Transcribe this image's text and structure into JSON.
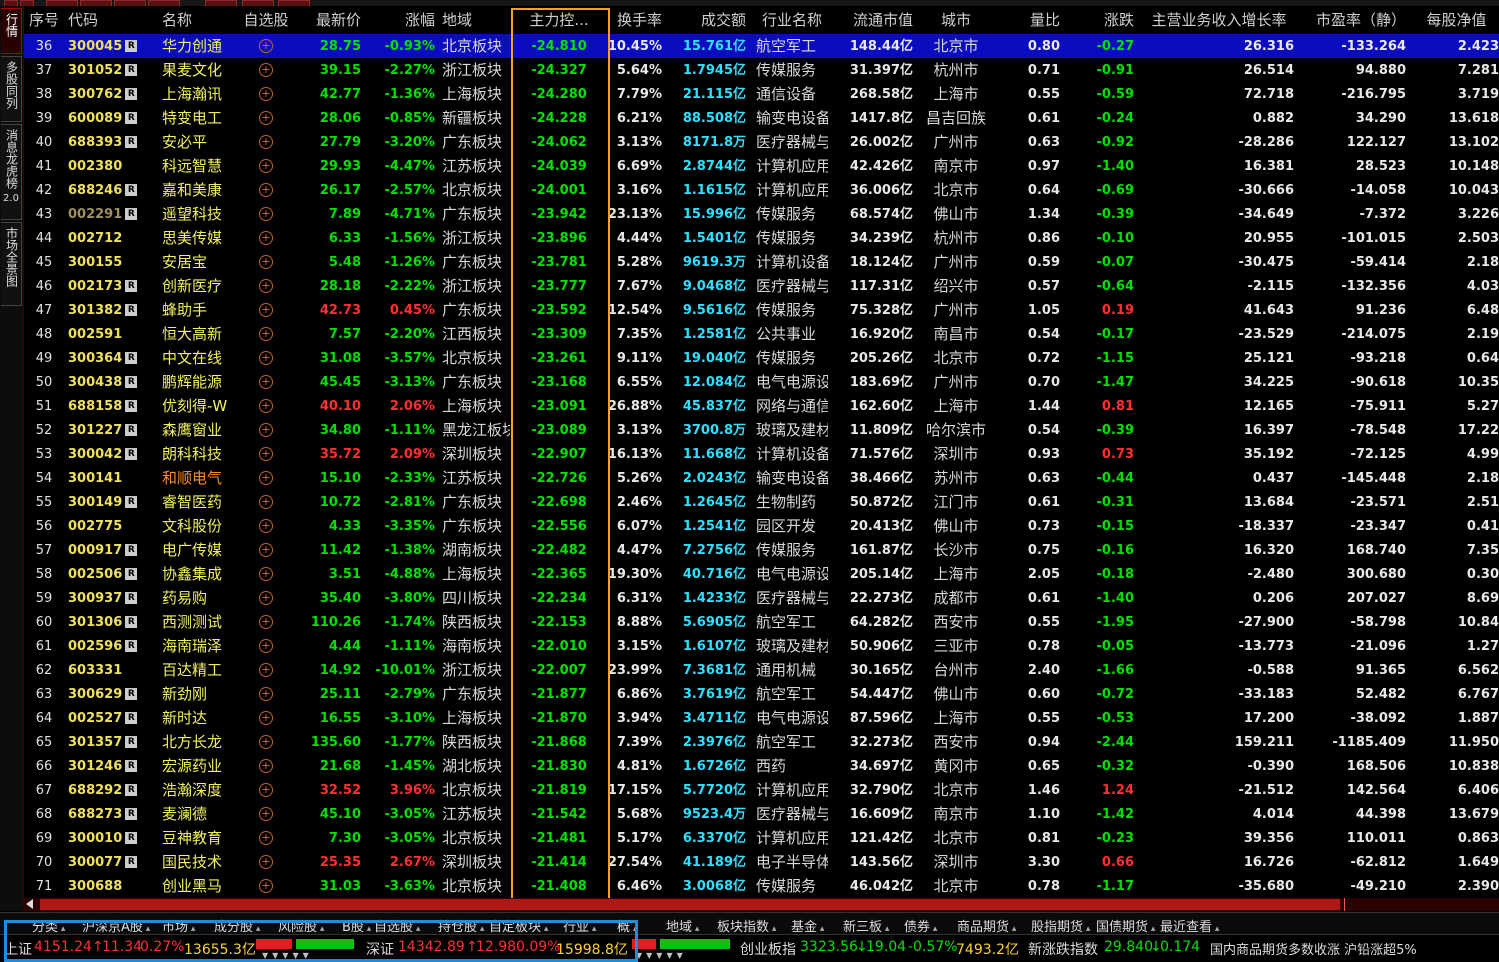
{
  "left_tabs": [
    {
      "label": "行情"
    },
    {
      "label": "多股同列"
    },
    {
      "label": "消息龙虎榜",
      "sub": "2.0"
    },
    {
      "label": "市场全景图"
    }
  ],
  "headers": [
    "序号",
    "代码",
    "名称",
    "自选股",
    "最新价",
    "涨幅",
    "地域",
    "主力控...",
    "换手率",
    "成交额",
    "行业名称",
    "流通市值",
    "城市",
    "量比",
    "涨跌",
    "主营业务收入增长率",
    "市盈率（静）",
    "每股净值"
  ],
  "rows": [
    {
      "seq": "36",
      "code": "300045",
      "r": true,
      "name": "华力创通",
      "price": "28.75",
      "chg_pct": "-0.93%",
      "region": "北京板块",
      "main": "-24.810",
      "turnover": "10.45%",
      "amount": "15.761亿",
      "industry": "航空军工",
      "mcap": "148.44亿",
      "city": "北京市",
      "vr": "0.80",
      "chg": "-0.27",
      "growth": "26.316",
      "pe": "-133.264",
      "bvps": "2.423",
      "selected": true
    },
    {
      "seq": "37",
      "code": "301052",
      "r": true,
      "name": "果麦文化",
      "price": "39.15",
      "chg_pct": "-2.27%",
      "region": "浙江板块",
      "main": "-24.327",
      "turnover": "5.64%",
      "amount": "1.7945亿",
      "industry": "传媒服务",
      "mcap": "31.397亿",
      "city": "杭州市",
      "vr": "0.71",
      "chg": "-0.91",
      "growth": "26.514",
      "pe": "94.880",
      "bvps": "7.281"
    },
    {
      "seq": "38",
      "code": "300762",
      "r": true,
      "name": "上海瀚讯",
      "price": "42.77",
      "chg_pct": "-1.36%",
      "region": "上海板块",
      "main": "-24.280",
      "turnover": "7.79%",
      "amount": "21.115亿",
      "industry": "通信设备",
      "mcap": "268.58亿",
      "city": "上海市",
      "vr": "0.55",
      "chg": "-0.59",
      "growth": "72.718",
      "pe": "-216.795",
      "bvps": "3.719"
    },
    {
      "seq": "39",
      "code": "600089",
      "r": true,
      "name": "特变电工",
      "price": "28.06",
      "chg_pct": "-0.85%",
      "region": "新疆板块",
      "main": "-24.228",
      "turnover": "6.21%",
      "amount": "88.508亿",
      "industry": "输变电设备",
      "mcap": "1417.8亿",
      "city": "昌吉回族",
      "vr": "0.61",
      "chg": "-0.24",
      "growth": "0.882",
      "pe": "34.290",
      "bvps": "13.618"
    },
    {
      "seq": "40",
      "code": "688393",
      "r": true,
      "name": "安必平",
      "price": "27.79",
      "chg_pct": "-3.20%",
      "region": "广东板块",
      "main": "-24.062",
      "turnover": "3.13%",
      "amount": "8171.8万",
      "industry": "医疗器械与",
      "mcap": "26.002亿",
      "city": "广州市",
      "vr": "0.63",
      "chg": "-0.92",
      "growth": "-28.286",
      "pe": "122.127",
      "bvps": "13.102"
    },
    {
      "seq": "41",
      "code": "002380",
      "r": false,
      "name": "科远智慧",
      "price": "29.93",
      "chg_pct": "-4.47%",
      "region": "江苏板块",
      "main": "-24.039",
      "turnover": "6.69%",
      "amount": "2.8744亿",
      "industry": "计算机应用",
      "mcap": "42.426亿",
      "city": "南京市",
      "vr": "0.97",
      "chg": "-1.40",
      "growth": "16.381",
      "pe": "28.523",
      "bvps": "10.148"
    },
    {
      "seq": "42",
      "code": "688246",
      "r": true,
      "name": "嘉和美康",
      "price": "26.17",
      "chg_pct": "-2.57%",
      "region": "北京板块",
      "main": "-24.001",
      "turnover": "3.16%",
      "amount": "1.1615亿",
      "industry": "计算机应用",
      "mcap": "36.006亿",
      "city": "北京市",
      "vr": "0.64",
      "chg": "-0.69",
      "growth": "-30.666",
      "pe": "-14.058",
      "bvps": "10.043"
    },
    {
      "seq": "43",
      "code": "002291",
      "r": true,
      "name": "遥望科技",
      "price": "7.89",
      "chg_pct": "-4.71%",
      "region": "广东板块",
      "main": "-23.942",
      "turnover": "23.13%",
      "amount": "15.996亿",
      "industry": "传媒服务",
      "mcap": "68.574亿",
      "city": "佛山市",
      "vr": "1.34",
      "chg": "-0.39",
      "growth": "-34.649",
      "pe": "-7.372",
      "bvps": "3.226",
      "dim": true
    },
    {
      "seq": "44",
      "code": "002712",
      "r": false,
      "name": "思美传媒",
      "price": "6.33",
      "chg_pct": "-1.56%",
      "region": "浙江板块",
      "main": "-23.896",
      "turnover": "4.44%",
      "amount": "1.5401亿",
      "industry": "传媒服务",
      "mcap": "34.239亿",
      "city": "杭州市",
      "vr": "0.86",
      "chg": "-0.10",
      "growth": "20.955",
      "pe": "-101.015",
      "bvps": "2.503"
    },
    {
      "seq": "45",
      "code": "300155",
      "r": false,
      "name": "安居宝",
      "price": "5.48",
      "chg_pct": "-1.26%",
      "region": "广东板块",
      "main": "-23.781",
      "turnover": "5.28%",
      "amount": "9619.3万",
      "industry": "计算机设备",
      "mcap": "18.124亿",
      "city": "广州市",
      "vr": "0.59",
      "chg": "-0.07",
      "growth": "-30.475",
      "pe": "-59.414",
      "bvps": "2.18"
    },
    {
      "seq": "46",
      "code": "002173",
      "r": true,
      "name": "创新医疗",
      "price": "28.18",
      "chg_pct": "-2.22%",
      "region": "浙江板块",
      "main": "-23.777",
      "turnover": "7.67%",
      "amount": "9.0468亿",
      "industry": "医疗器械与",
      "mcap": "117.31亿",
      "city": "绍兴市",
      "vr": "0.57",
      "chg": "-0.64",
      "growth": "-2.115",
      "pe": "-132.356",
      "bvps": "4.03"
    },
    {
      "seq": "47",
      "code": "301382",
      "r": true,
      "name": "蜂助手",
      "price": "42.73",
      "chg_pct": "0.45%",
      "region": "广东板块",
      "main": "-23.592",
      "turnover": "12.54%",
      "amount": "9.5616亿",
      "industry": "传媒服务",
      "mcap": "75.328亿",
      "city": "广州市",
      "vr": "1.05",
      "chg": "0.19",
      "growth": "41.643",
      "pe": "91.236",
      "bvps": "6.48",
      "up": true
    },
    {
      "seq": "48",
      "code": "002591",
      "r": false,
      "name": "恒大高新",
      "price": "7.57",
      "chg_pct": "-2.20%",
      "region": "江西板块",
      "main": "-23.309",
      "turnover": "7.35%",
      "amount": "1.2581亿",
      "industry": "公共事业",
      "mcap": "16.920亿",
      "city": "南昌市",
      "vr": "0.54",
      "chg": "-0.17",
      "growth": "-23.529",
      "pe": "-214.075",
      "bvps": "2.19"
    },
    {
      "seq": "49",
      "code": "300364",
      "r": true,
      "name": "中文在线",
      "price": "31.08",
      "chg_pct": "-3.57%",
      "region": "北京板块",
      "main": "-23.261",
      "turnover": "9.11%",
      "amount": "19.040亿",
      "industry": "传媒服务",
      "mcap": "205.26亿",
      "city": "北京市",
      "vr": "0.72",
      "chg": "-1.15",
      "growth": "25.121",
      "pe": "-93.218",
      "bvps": "0.64"
    },
    {
      "seq": "50",
      "code": "300438",
      "r": true,
      "name": "鹏辉能源",
      "price": "45.45",
      "chg_pct": "-3.13%",
      "region": "广东板块",
      "main": "-23.168",
      "turnover": "6.55%",
      "amount": "12.084亿",
      "industry": "电气电源设",
      "mcap": "183.69亿",
      "city": "广州市",
      "vr": "0.70",
      "chg": "-1.47",
      "growth": "34.225",
      "pe": "-90.618",
      "bvps": "10.35"
    },
    {
      "seq": "51",
      "code": "688158",
      "r": true,
      "name": "优刻得-W",
      "price": "40.10",
      "chg_pct": "2.06%",
      "region": "上海板块",
      "main": "-23.091",
      "turnover": "26.88%",
      "amount": "45.837亿",
      "industry": "网络与通信",
      "mcap": "162.60亿",
      "city": "上海市",
      "vr": "1.44",
      "chg": "0.81",
      "growth": "12.165",
      "pe": "-75.911",
      "bvps": "5.27",
      "up": true
    },
    {
      "seq": "52",
      "code": "301227",
      "r": true,
      "name": "森鹰窗业",
      "price": "34.80",
      "chg_pct": "-1.11%",
      "region": "黑龙江板块",
      "main": "-23.089",
      "turnover": "3.13%",
      "amount": "3700.8万",
      "industry": "玻璃及建材",
      "mcap": "11.809亿",
      "city": "哈尔滨市",
      "vr": "0.54",
      "chg": "-0.39",
      "growth": "16.397",
      "pe": "-78.548",
      "bvps": "17.22"
    },
    {
      "seq": "53",
      "code": "300042",
      "r": true,
      "name": "朗科科技",
      "price": "35.72",
      "chg_pct": "2.09%",
      "region": "深圳板块",
      "main": "-22.907",
      "turnover": "16.13%",
      "amount": "11.668亿",
      "industry": "计算机设备",
      "mcap": "71.576亿",
      "city": "深圳市",
      "vr": "0.93",
      "chg": "0.73",
      "growth": "35.192",
      "pe": "-72.125",
      "bvps": "4.99",
      "up": true
    },
    {
      "seq": "54",
      "code": "300141",
      "r": false,
      "name": "和顺电气",
      "price": "15.10",
      "chg_pct": "-2.33%",
      "region": "江苏板块",
      "main": "-22.726",
      "turnover": "5.26%",
      "amount": "2.0243亿",
      "industry": "输变电设备",
      "mcap": "38.466亿",
      "city": "苏州市",
      "vr": "0.63",
      "chg": "-0.44",
      "growth": "0.437",
      "pe": "-145.448",
      "bvps": "2.18",
      "orange": true
    },
    {
      "seq": "55",
      "code": "300149",
      "r": true,
      "name": "睿智医药",
      "price": "10.72",
      "chg_pct": "-2.81%",
      "region": "广东板块",
      "main": "-22.698",
      "turnover": "2.46%",
      "amount": "1.2645亿",
      "industry": "生物制药",
      "mcap": "50.872亿",
      "city": "江门市",
      "vr": "0.61",
      "chg": "-0.31",
      "growth": "13.684",
      "pe": "-23.571",
      "bvps": "2.51"
    },
    {
      "seq": "56",
      "code": "002775",
      "r": false,
      "name": "文科股份",
      "price": "4.33",
      "chg_pct": "-3.35%",
      "region": "广东板块",
      "main": "-22.556",
      "turnover": "6.07%",
      "amount": "1.2541亿",
      "industry": "园区开发",
      "mcap": "20.413亿",
      "city": "佛山市",
      "vr": "0.73",
      "chg": "-0.15",
      "growth": "-18.337",
      "pe": "-23.347",
      "bvps": "0.41"
    },
    {
      "seq": "57",
      "code": "000917",
      "r": true,
      "name": "电广传媒",
      "price": "11.42",
      "chg_pct": "-1.38%",
      "region": "湖南板块",
      "main": "-22.482",
      "turnover": "4.47%",
      "amount": "7.2756亿",
      "industry": "传媒服务",
      "mcap": "161.87亿",
      "city": "长沙市",
      "vr": "0.75",
      "chg": "-0.16",
      "growth": "16.320",
      "pe": "168.740",
      "bvps": "7.35"
    },
    {
      "seq": "58",
      "code": "002506",
      "r": true,
      "name": "协鑫集成",
      "price": "3.51",
      "chg_pct": "-4.88%",
      "region": "上海板块",
      "main": "-22.365",
      "turnover": "19.30%",
      "amount": "40.716亿",
      "industry": "电气电源设",
      "mcap": "205.14亿",
      "city": "上海市",
      "vr": "2.05",
      "chg": "-0.18",
      "growth": "-2.480",
      "pe": "300.680",
      "bvps": "0.30"
    },
    {
      "seq": "59",
      "code": "300937",
      "r": true,
      "name": "药易购",
      "price": "35.40",
      "chg_pct": "-3.80%",
      "region": "四川板块",
      "main": "-22.234",
      "turnover": "6.31%",
      "amount": "1.4233亿",
      "industry": "医疗器械与",
      "mcap": "22.273亿",
      "city": "成都市",
      "vr": "0.61",
      "chg": "-1.40",
      "growth": "0.206",
      "pe": "207.027",
      "bvps": "8.69"
    },
    {
      "seq": "60",
      "code": "301306",
      "r": true,
      "name": "西测测试",
      "price": "110.26",
      "chg_pct": "-1.74%",
      "region": "陕西板块",
      "main": "-22.153",
      "turnover": "8.88%",
      "amount": "5.6905亿",
      "industry": "航空军工",
      "mcap": "64.282亿",
      "city": "西安市",
      "vr": "0.55",
      "chg": "-1.95",
      "growth": "-27.900",
      "pe": "-58.798",
      "bvps": "10.84"
    },
    {
      "seq": "61",
      "code": "002596",
      "r": true,
      "name": "海南瑞泽",
      "price": "4.44",
      "chg_pct": "-1.11%",
      "region": "海南板块",
      "main": "-22.010",
      "turnover": "3.15%",
      "amount": "1.6107亿",
      "industry": "玻璃及建材",
      "mcap": "50.906亿",
      "city": "三亚市",
      "vr": "0.78",
      "chg": "-0.05",
      "growth": "-13.773",
      "pe": "-21.096",
      "bvps": "1.27"
    },
    {
      "seq": "62",
      "code": "603331",
      "r": false,
      "name": "百达精工",
      "price": "14.92",
      "chg_pct": "-10.01%",
      "region": "浙江板块",
      "main": "-22.007",
      "turnover": "23.99%",
      "amount": "7.3681亿",
      "industry": "通用机械",
      "mcap": "30.165亿",
      "city": "台州市",
      "vr": "2.40",
      "chg": "-1.66",
      "growth": "-0.588",
      "pe": "91.365",
      "bvps": "6.562"
    },
    {
      "seq": "63",
      "code": "300629",
      "r": true,
      "name": "新劲刚",
      "price": "25.11",
      "chg_pct": "-2.79%",
      "region": "广东板块",
      "main": "-21.877",
      "turnover": "6.86%",
      "amount": "3.7619亿",
      "industry": "航空军工",
      "mcap": "54.447亿",
      "city": "佛山市",
      "vr": "0.60",
      "chg": "-0.72",
      "growth": "-33.183",
      "pe": "52.482",
      "bvps": "6.767"
    },
    {
      "seq": "64",
      "code": "002527",
      "r": true,
      "name": "新时达",
      "price": "16.55",
      "chg_pct": "-3.10%",
      "region": "上海板块",
      "main": "-21.870",
      "turnover": "3.94%",
      "amount": "3.4711亿",
      "industry": "电气电源设",
      "mcap": "87.596亿",
      "city": "上海市",
      "vr": "0.55",
      "chg": "-0.53",
      "growth": "17.200",
      "pe": "-38.092",
      "bvps": "1.887"
    },
    {
      "seq": "65",
      "code": "301357",
      "r": true,
      "name": "北方长龙",
      "price": "135.60",
      "chg_pct": "-1.77%",
      "region": "陕西板块",
      "main": "-21.868",
      "turnover": "7.39%",
      "amount": "2.3976亿",
      "industry": "航空军工",
      "mcap": "32.273亿",
      "city": "西安市",
      "vr": "0.94",
      "chg": "-2.44",
      "growth": "159.211",
      "pe": "-1185.409",
      "bvps": "11.950"
    },
    {
      "seq": "66",
      "code": "301246",
      "r": true,
      "name": "宏源药业",
      "price": "21.68",
      "chg_pct": "-1.45%",
      "region": "湖北板块",
      "main": "-21.830",
      "turnover": "4.81%",
      "amount": "1.6726亿",
      "industry": "西药",
      "mcap": "34.697亿",
      "city": "黄冈市",
      "vr": "0.65",
      "chg": "-0.32",
      "growth": "-0.390",
      "pe": "168.506",
      "bvps": "10.838"
    },
    {
      "seq": "67",
      "code": "688292",
      "r": true,
      "name": "浩瀚深度",
      "price": "32.52",
      "chg_pct": "3.96%",
      "region": "北京板块",
      "main": "-21.819",
      "turnover": "17.15%",
      "amount": "5.7720亿",
      "industry": "计算机应用",
      "mcap": "32.790亿",
      "city": "北京市",
      "vr": "1.46",
      "chg": "1.24",
      "growth": "-21.512",
      "pe": "142.564",
      "bvps": "6.406",
      "up": true
    },
    {
      "seq": "68",
      "code": "688273",
      "r": true,
      "name": "麦澜德",
      "price": "45.10",
      "chg_pct": "-3.05%",
      "region": "江苏板块",
      "main": "-21.542",
      "turnover": "5.68%",
      "amount": "9523.4万",
      "industry": "医疗器械与",
      "mcap": "16.609亿",
      "city": "南京市",
      "vr": "1.10",
      "chg": "-1.42",
      "growth": "4.014",
      "pe": "44.398",
      "bvps": "13.679"
    },
    {
      "seq": "69",
      "code": "300010",
      "r": true,
      "name": "豆神教育",
      "price": "7.30",
      "chg_pct": "-3.05%",
      "region": "北京板块",
      "main": "-21.481",
      "turnover": "5.17%",
      "amount": "6.3370亿",
      "industry": "计算机应用",
      "mcap": "121.42亿",
      "city": "北京市",
      "vr": "0.81",
      "chg": "-0.23",
      "growth": "39.356",
      "pe": "110.011",
      "bvps": "0.863"
    },
    {
      "seq": "70",
      "code": "300077",
      "r": true,
      "name": "国民技术",
      "price": "25.35",
      "chg_pct": "2.67%",
      "region": "深圳板块",
      "main": "-21.414",
      "turnover": "27.54%",
      "amount": "41.189亿",
      "industry": "电子半导体",
      "mcap": "143.56亿",
      "city": "深圳市",
      "vr": "3.30",
      "chg": "0.66",
      "growth": "16.726",
      "pe": "-62.812",
      "bvps": "1.649",
      "up": true
    },
    {
      "seq": "71",
      "code": "300688",
      "r": false,
      "name": "创业黑马",
      "price": "31.03",
      "chg_pct": "-3.63%",
      "region": "北京板块",
      "main": "-21.408",
      "turnover": "6.46%",
      "amount": "3.0068亿",
      "industry": "传媒服务",
      "mcap": "46.042亿",
      "city": "北京市",
      "vr": "0.78",
      "chg": "-1.17",
      "growth": "-35.680",
      "pe": "-49.210",
      "bvps": "2.390"
    }
  ],
  "bottom_tabs": [
    "分类",
    "沪深京A股",
    "市场",
    "成分股",
    "风险股",
    "B股",
    "自选股",
    "持仓股",
    "自定板块",
    "行业",
    "概",
    "地域",
    "板块指数",
    "基金",
    "新三板",
    "债券",
    "商品期货",
    "股指期货",
    "国债期货",
    "最近查看"
  ],
  "status": {
    "sh": {
      "name": "上证",
      "value": "4151.24",
      "arrow": "↑",
      "chg": "11.34",
      "pct": "0.27%",
      "amount": "13655.3亿"
    },
    "sz": {
      "name": "深证",
      "value": "14342.89",
      "arrow": "↑",
      "chg": "12.98",
      "pct": "0.09%",
      "amount": "15998.8亿"
    },
    "cy": {
      "name": "创业板指",
      "value": "3323.56",
      "arrow": "↓",
      "chg": "19.04",
      "pct": "-0.57%",
      "amount": "7493.2亿"
    },
    "xzd": {
      "name": "新涨跌指数",
      "value": "29.840",
      "arrow": "↓",
      "chg": "0.174"
    },
    "ticker": "国内商品期货多数收涨  沪铅涨超5%"
  },
  "colors": {
    "up": "#ff3030",
    "down": "#00e000",
    "highlight_box": "#f2a21e",
    "status_box": "#1a8fe0",
    "selected_row": "#0b0bbf"
  }
}
